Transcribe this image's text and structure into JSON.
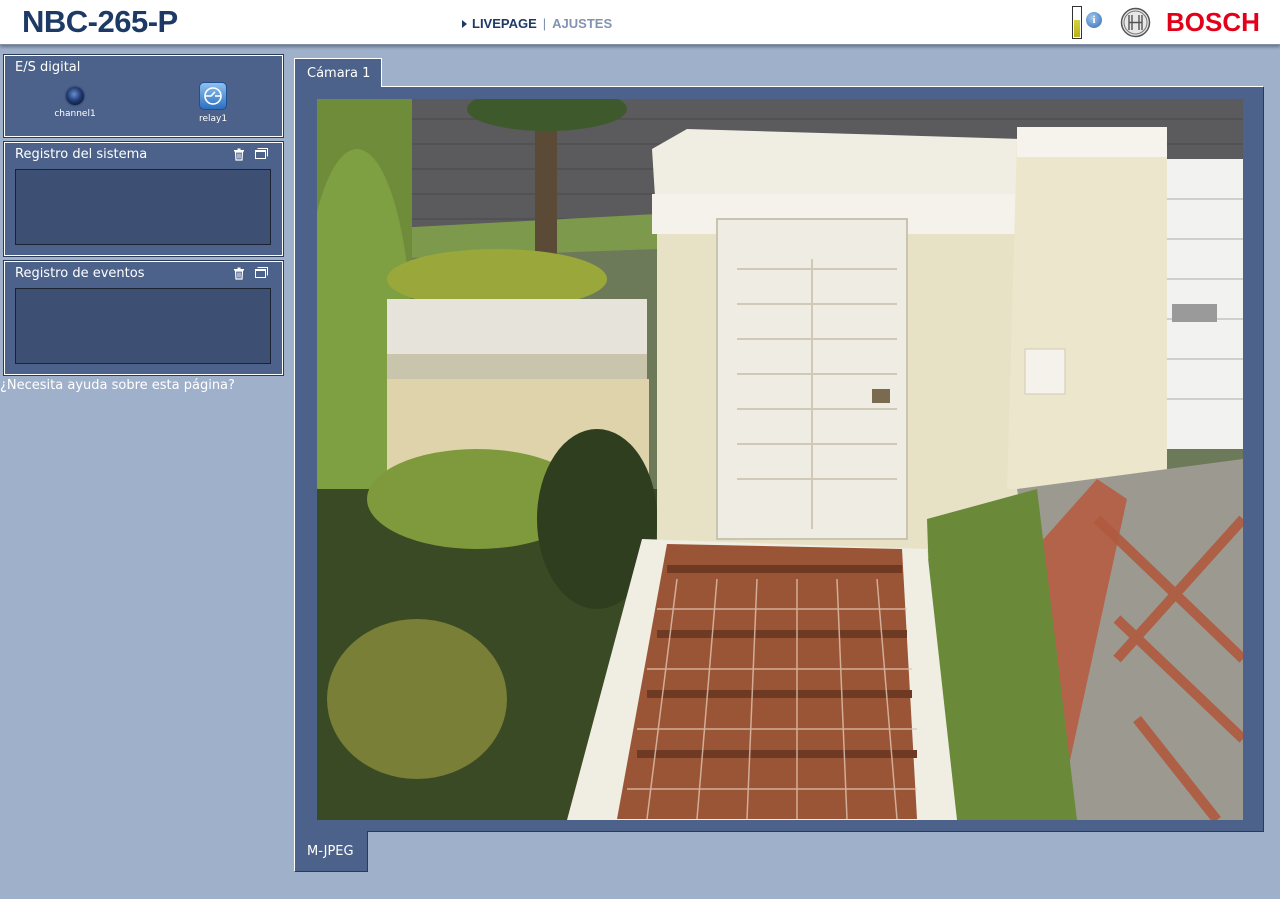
{
  "header": {
    "model": "NBC-265-P",
    "nav": {
      "live_label": "LIVEPAGE",
      "separator": "|",
      "settings_label": "AJUSTES"
    },
    "brand": "BOSCH"
  },
  "digital_io": {
    "title": "E/S digital",
    "items": [
      {
        "label": "channel1",
        "icon": "input-led-icon"
      },
      {
        "label": "relay1",
        "icon": "relay-button-icon"
      }
    ]
  },
  "system_log": {
    "title": "Registro del sistema"
  },
  "event_log": {
    "title": "Registro de eventos"
  },
  "help_link": "¿Necesita ayuda sobre esta página?",
  "camera": {
    "tab_label": "Cámara 1",
    "stream_format": "M-JPEG"
  }
}
